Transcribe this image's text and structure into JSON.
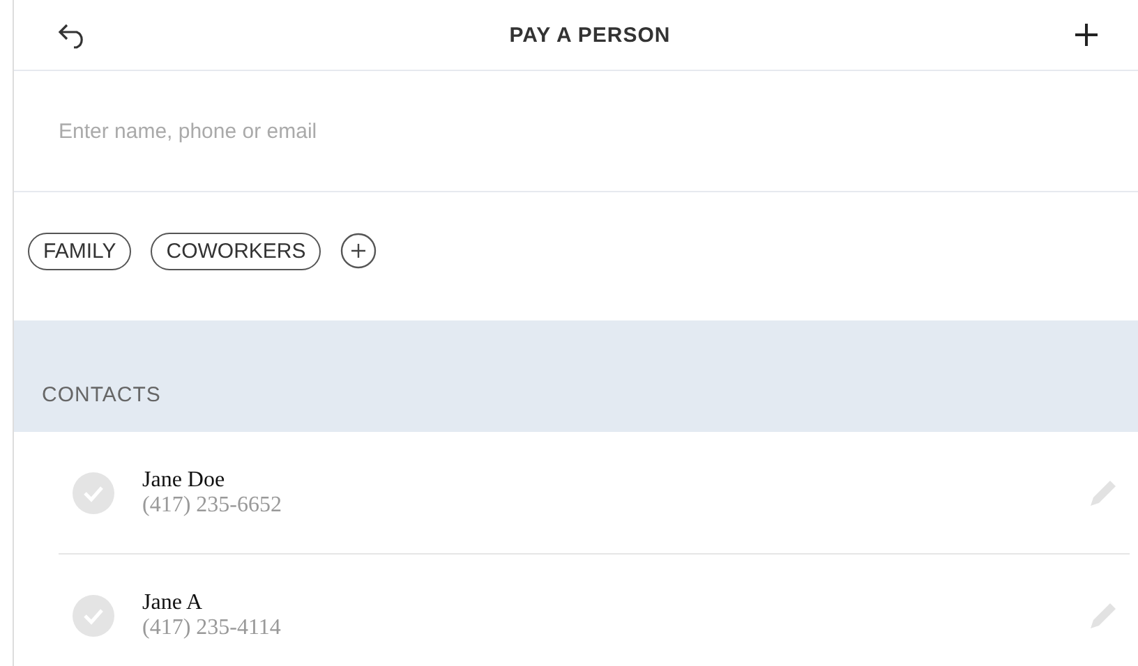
{
  "header": {
    "title": "PAY A PERSON"
  },
  "search": {
    "placeholder": "Enter name, phone or email"
  },
  "groups": [
    {
      "label": "FAMILY"
    },
    {
      "label": "COWORKERS"
    }
  ],
  "contacts_header": "CONTACTS",
  "contacts": [
    {
      "name": "Jane Doe",
      "phone": "(417) 235-6652",
      "selected": false
    },
    {
      "name": "Jane A",
      "phone": "(417) 235-4114",
      "selected": false
    }
  ]
}
